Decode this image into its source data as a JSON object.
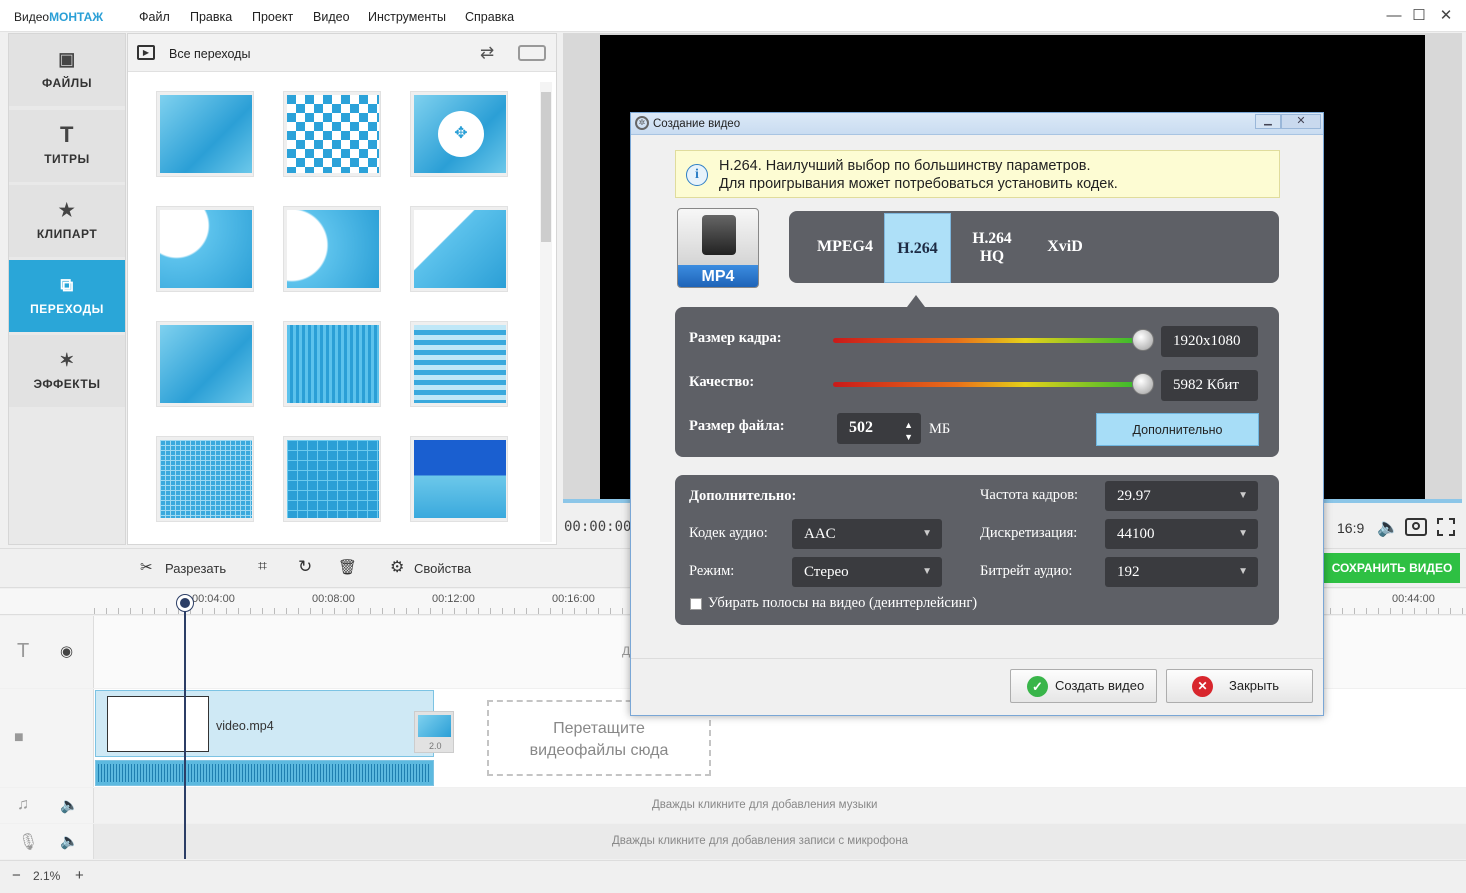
{
  "app": {
    "title_prefix": "Видео",
    "title_brand": "МОНТАЖ"
  },
  "menu": [
    "Файл",
    "Правка",
    "Проект",
    "Видео",
    "Инструменты",
    "Справка"
  ],
  "window_controls": {
    "minimize": "—",
    "maximize": "☐",
    "close": "✕"
  },
  "sidebar": [
    {
      "label": "ФАЙЛЫ",
      "icon": "image-icon",
      "glyph": "▣"
    },
    {
      "label": "ТИТРЫ",
      "icon": "text-icon",
      "glyph": "T"
    },
    {
      "label": "КЛИПАРТ",
      "icon": "star-icon",
      "glyph": "★"
    },
    {
      "label": "ПЕРЕХОДЫ",
      "icon": "transitions-icon",
      "glyph": "⧉",
      "active": true
    },
    {
      "label": "ЭФФЕКТЫ",
      "icon": "magic-wand-icon",
      "glyph": "✶"
    }
  ],
  "transitions_panel": {
    "title": "Все переходы"
  },
  "preview": {
    "timecode": "00:00:00.0",
    "ratio": "16:9",
    "save_label": "СОХРАНИТЬ ВИДЕО"
  },
  "toolbar": {
    "cut": "Разрезать",
    "properties": "Свойства"
  },
  "ruler": {
    "labels": [
      "00:04:00",
      "00:08:00",
      "00:12:00",
      "00:16:00",
      "00:44:00"
    ]
  },
  "timeline": {
    "clip_name": "video.mp4",
    "transition_duration": "2.0",
    "drop_hint_line1": "Перетащите",
    "drop_hint_line2": "видеофайлы сюда",
    "music_hint": "Дважды кликните для добавления музыки",
    "mic_hint": "Дважды кликните для добавления записи с микрофона",
    "title_hint_fragment": "Д"
  },
  "statusbar": {
    "zoom_minus": "−",
    "zoom": "2.1%",
    "zoom_plus": "+"
  },
  "dialog": {
    "title": "Создание видео",
    "info_line1": "H.264. Наилучший выбор по большинству параметров.",
    "info_line2": "Для проигрывания может потребоваться установить кодек.",
    "format_label": "MP4",
    "codecs": [
      {
        "label": "MPEG4"
      },
      {
        "label": "H.264",
        "selected": true
      },
      {
        "label": "H.264 HQ"
      },
      {
        "label": "XviD"
      }
    ],
    "frame_size_label": "Размер кадра:",
    "frame_size_value": "1920x1080",
    "frame_size_level": 1.0,
    "quality_label": "Качество:",
    "quality_value": "5982 Кбит",
    "quality_level": 1.0,
    "file_size_label": "Размер файла:",
    "file_size_value": "502",
    "file_size_unit": "МБ",
    "more_button": "Дополнительно",
    "advanced_label": "Дополнительно:",
    "fps_label": "Частота кадров:",
    "fps_value": "29.97",
    "audio_codec_label": "Кодек аудио:",
    "audio_codec_value": "AAC",
    "sample_rate_label": "Дискретизация:",
    "sample_rate_value": "44100",
    "mode_label": "Режим:",
    "mode_value": "Стерео",
    "audio_bitrate_label": "Битрейт аудио:",
    "audio_bitrate_value": "192",
    "deinterlace_label": "Убирать полосы на видео (деинтерлейсинг)",
    "deinterlace_checked": false,
    "create_button": "Создать видео",
    "close_button": "Закрыть"
  }
}
